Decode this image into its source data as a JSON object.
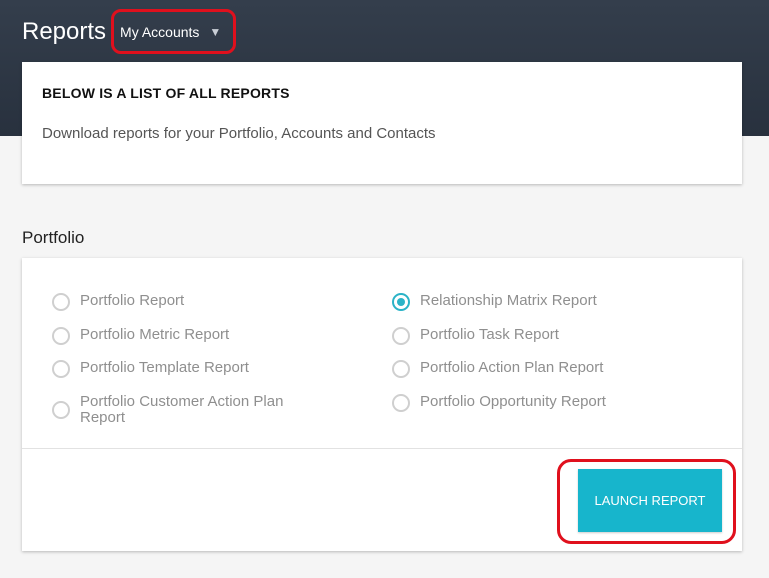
{
  "header": {
    "title": "Reports",
    "account_select": {
      "value": "My Accounts",
      "icon": "caret-down-icon"
    }
  },
  "intro": {
    "heading": "BELOW IS A LIST OF ALL REPORTS",
    "subtext": "Download reports for your Portfolio, Accounts and Contacts"
  },
  "portfolio": {
    "title": "Portfolio",
    "options": [
      {
        "label": "Portfolio Report",
        "checked": false
      },
      {
        "label": "Portfolio Metric Report",
        "checked": false
      },
      {
        "label": "Portfolio Template Report",
        "checked": false
      },
      {
        "label": "Portfolio Customer Action Plan Report",
        "checked": false
      },
      {
        "label": "Relationship Matrix Report",
        "checked": true
      },
      {
        "label": "Portfolio Task Report",
        "checked": false
      },
      {
        "label": "Portfolio Action Plan Report",
        "checked": false
      },
      {
        "label": "Portfolio Opportunity Report",
        "checked": false
      }
    ],
    "launch_label": "LAUNCH REPORT"
  },
  "colors": {
    "header_bg": "#2f3846",
    "accent": "#17b5cc",
    "annotation": "#e0101d"
  }
}
